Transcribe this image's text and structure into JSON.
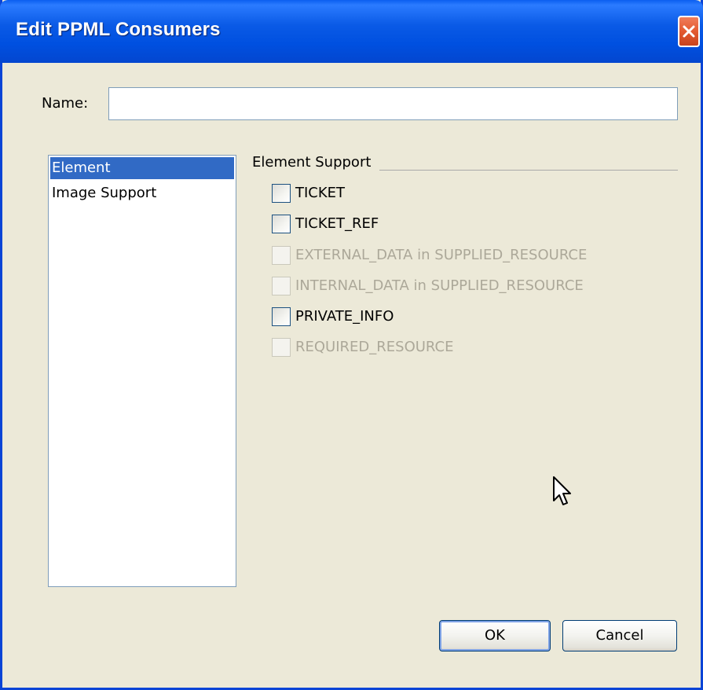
{
  "window": {
    "title": "Edit PPML Consumers"
  },
  "name_field": {
    "label": "Name:",
    "value": ""
  },
  "categories": [
    {
      "label": "Element",
      "selected": true
    },
    {
      "label": "Image Support",
      "selected": false
    }
  ],
  "element_support": {
    "title": "Element Support",
    "options": [
      {
        "label": "TICKET",
        "checked": false,
        "enabled": true
      },
      {
        "label": "TICKET_REF",
        "checked": false,
        "enabled": true
      },
      {
        "label": "EXTERNAL_DATA in SUPPLIED_RESOURCE",
        "checked": false,
        "enabled": false
      },
      {
        "label": "INTERNAL_DATA in SUPPLIED_RESOURCE",
        "checked": false,
        "enabled": false
      },
      {
        "label": "PRIVATE_INFO",
        "checked": false,
        "enabled": true
      },
      {
        "label": "REQUIRED_RESOURCE",
        "checked": false,
        "enabled": false
      }
    ]
  },
  "buttons": {
    "ok": "OK",
    "cancel": "Cancel"
  },
  "colors": {
    "titlebar": "#0a5ae6",
    "selection": "#316ac5",
    "dialog_bg": "#ece9d8",
    "close": "#e35a30"
  }
}
